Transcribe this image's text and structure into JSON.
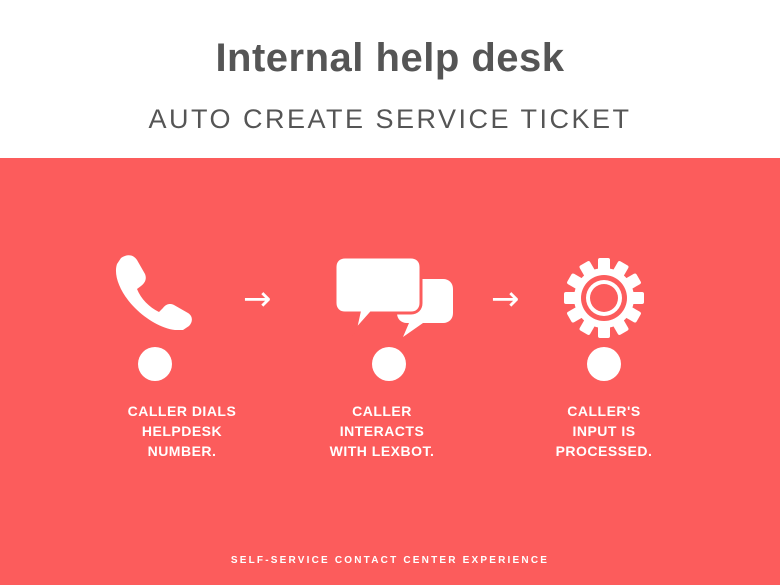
{
  "header": {
    "title": "Internal help desk",
    "subtitle": "AUTO CREATE SERVICE TICKET"
  },
  "colors": {
    "panel": "#fc5c5c",
    "text_dark": "#555555",
    "icon": "#ffffff"
  },
  "steps": [
    {
      "icon": "phone-icon",
      "label": "CALLER DIALS\nHELPDESK\nNUMBER."
    },
    {
      "icon": "chat-bubbles-icon",
      "label": "CALLER\nINTERACTS\nWITH LEXBOT."
    },
    {
      "icon": "gear-icon",
      "label": "CALLER'S\nINPUT IS\nPROCESSED."
    }
  ],
  "arrows": [
    "→",
    "→"
  ],
  "footer": "SELF-SERVICE CONTACT CENTER EXPERIENCE"
}
